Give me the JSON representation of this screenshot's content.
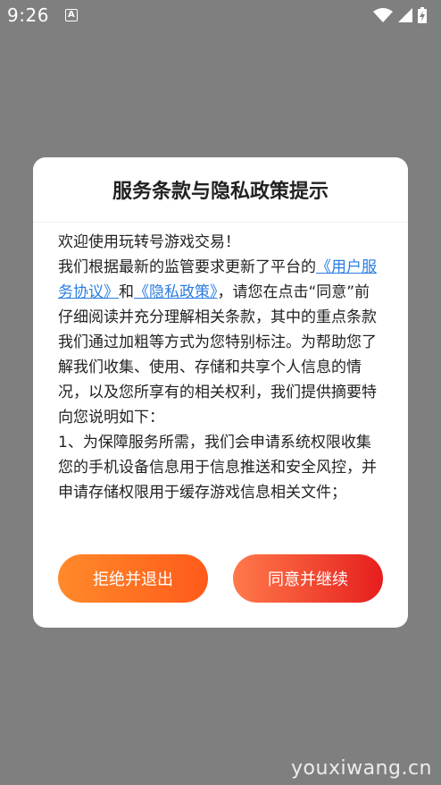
{
  "status_bar": {
    "time": "9:26",
    "notification_icon": "a-box-icon",
    "wifi_icon": "wifi-icon",
    "signal_icon": "signal-icon",
    "battery_icon": "battery-charging-icon"
  },
  "dialog": {
    "title": "服务条款与隐私政策提示",
    "body": {
      "line1": "欢迎使用玩转号游戏交易！",
      "para2_prefix": "我们根据最新的监管要求更新了平台的",
      "user_agreement_link": "《用户服务协议》",
      "and_text": "和",
      "privacy_policy_link": "《隐私政策》",
      "para2_suffix": "，请您在点击“同意”前仔细阅读并充分理解相关条款，其中的重点条款我们通过加粗等方式为您特别标注。为帮助您了解我们收集、使用、存储和共享个人信息的情况，以及您所享有的相关权利，我们提供摘要特向您说明如下：",
      "para3": "1、为保障服务所需，我们会申请系统权限收集您的手机设备信息用于信息推送和安全风控，并申请存储权限用于缓存游戏信息相关文件；"
    },
    "refuse_button": "拒绝并退出",
    "agree_button": "同意并继续"
  },
  "watermark": "youxiwang.cn",
  "colors": {
    "overlay": "#7f7f7f",
    "link": "#2a7de1",
    "refuse_gradient": [
      "#ff8a2a",
      "#ff5a1a"
    ],
    "agree_gradient": [
      "#ff7a4a",
      "#e61e1e"
    ]
  }
}
